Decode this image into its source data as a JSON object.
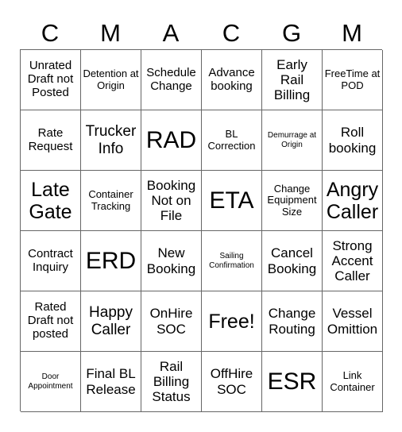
{
  "header": {
    "letters": [
      "C",
      "M",
      "A",
      "C",
      "G",
      "M"
    ]
  },
  "cells": [
    {
      "text": "Unrated Draft not Posted",
      "size": "s-md"
    },
    {
      "text": "Detention at Origin",
      "size": "s-sm"
    },
    {
      "text": "Schedule Change",
      "size": "s-md"
    },
    {
      "text": "Advance booking",
      "size": "s-md"
    },
    {
      "text": "Early Rail Billing",
      "size": "s-lg"
    },
    {
      "text": "FreeTime at POD",
      "size": "s-sm"
    },
    {
      "text": "Rate Request",
      "size": "s-md"
    },
    {
      "text": "Trucker Info",
      "size": "s-xl"
    },
    {
      "text": "RAD",
      "size": "s-big"
    },
    {
      "text": "BL Correction",
      "size": "s-sm"
    },
    {
      "text": "Demurrage at Origin",
      "size": "s-xs"
    },
    {
      "text": "Roll booking",
      "size": "s-lg"
    },
    {
      "text": "Late Gate",
      "size": "s-xxl"
    },
    {
      "text": "Container Tracking",
      "size": "s-sm"
    },
    {
      "text": "Booking Not on File",
      "size": "s-lg"
    },
    {
      "text": "ETA",
      "size": "s-big"
    },
    {
      "text": "Change Equipment Size",
      "size": "s-sm"
    },
    {
      "text": "Angry Caller",
      "size": "s-xxl"
    },
    {
      "text": "Contract Inquiry",
      "size": "s-md"
    },
    {
      "text": "ERD",
      "size": "s-big"
    },
    {
      "text": "New Booking",
      "size": "s-lg"
    },
    {
      "text": "Sailing Confirmation",
      "size": "s-xs"
    },
    {
      "text": "Cancel Booking",
      "size": "s-lg"
    },
    {
      "text": "Strong Accent Caller",
      "size": "s-lg"
    },
    {
      "text": "Rated Draft not posted",
      "size": "s-md"
    },
    {
      "text": "Happy Caller",
      "size": "s-xl"
    },
    {
      "text": "OnHire SOC",
      "size": "s-lg"
    },
    {
      "text": "Free!",
      "size": "s-xxl"
    },
    {
      "text": "Change Routing",
      "size": "s-lg"
    },
    {
      "text": "Vessel Omittion",
      "size": "s-lg"
    },
    {
      "text": "Door Appointment",
      "size": "s-xs"
    },
    {
      "text": "Final BL Release",
      "size": "s-lg"
    },
    {
      "text": "Rail Billing Status",
      "size": "s-lg"
    },
    {
      "text": "OffHire SOC",
      "size": "s-lg"
    },
    {
      "text": "ESR",
      "size": "s-big"
    },
    {
      "text": "Link Container",
      "size": "s-sm"
    }
  ]
}
